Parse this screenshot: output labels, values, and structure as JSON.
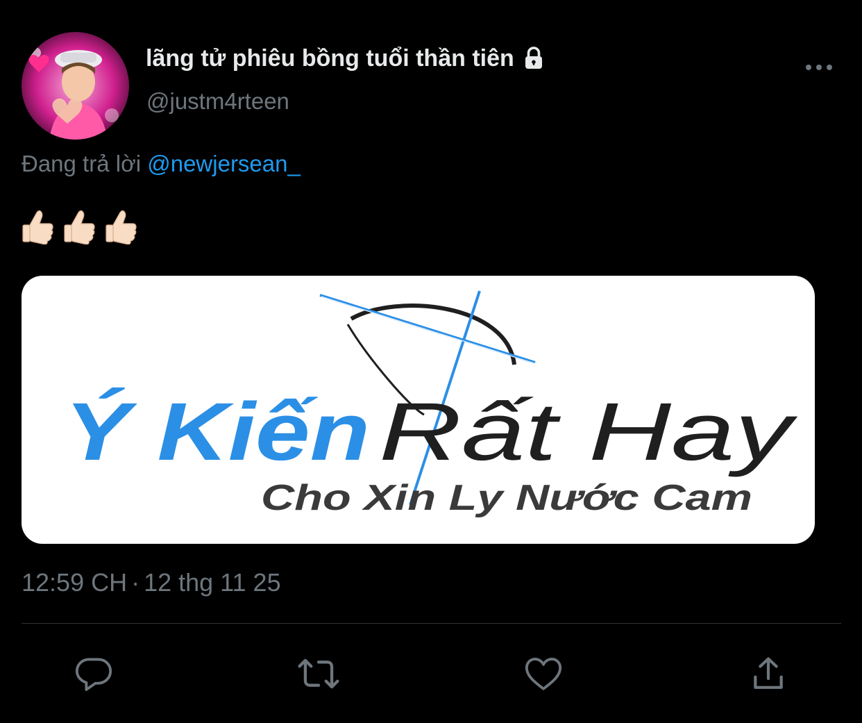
{
  "tweet": {
    "author": {
      "display_name": "lãng tử phiêu bồng tuổi thần tiên",
      "handle": "@justm4rteen",
      "protected_icon": "lock-icon",
      "avatar_icon": "avatar-photo"
    },
    "reply_context": {
      "prefix": "Đang trả lời",
      "mention": "@newjersean_"
    },
    "text_emoji": [
      "thumbs-up-icon",
      "thumbs-up-icon",
      "thumbs-up-icon"
    ],
    "media": {
      "title_blue": "Ý Kiến",
      "title_dark": "Rất Hay",
      "subtitle": "Cho Xin Ly Nước Cam",
      "blue": "#2b8fe6",
      "dark": "#1f1f1f"
    },
    "timestamp": {
      "time": "12:59 CH",
      "separator": "·",
      "date": "12 thg 11 25"
    },
    "actions": {
      "reply_icon": "comment-bubble-icon",
      "retweet_icon": "retweet-icon",
      "like_icon": "heart-icon",
      "share_icon": "share-upload-icon",
      "more_icon": "ellipsis-icon"
    }
  },
  "colors": {
    "background": "#000000",
    "primary_text": "#e7e9ea",
    "secondary_text": "#6e767d",
    "link": "#1d9bf0",
    "divider": "#2f3336"
  }
}
